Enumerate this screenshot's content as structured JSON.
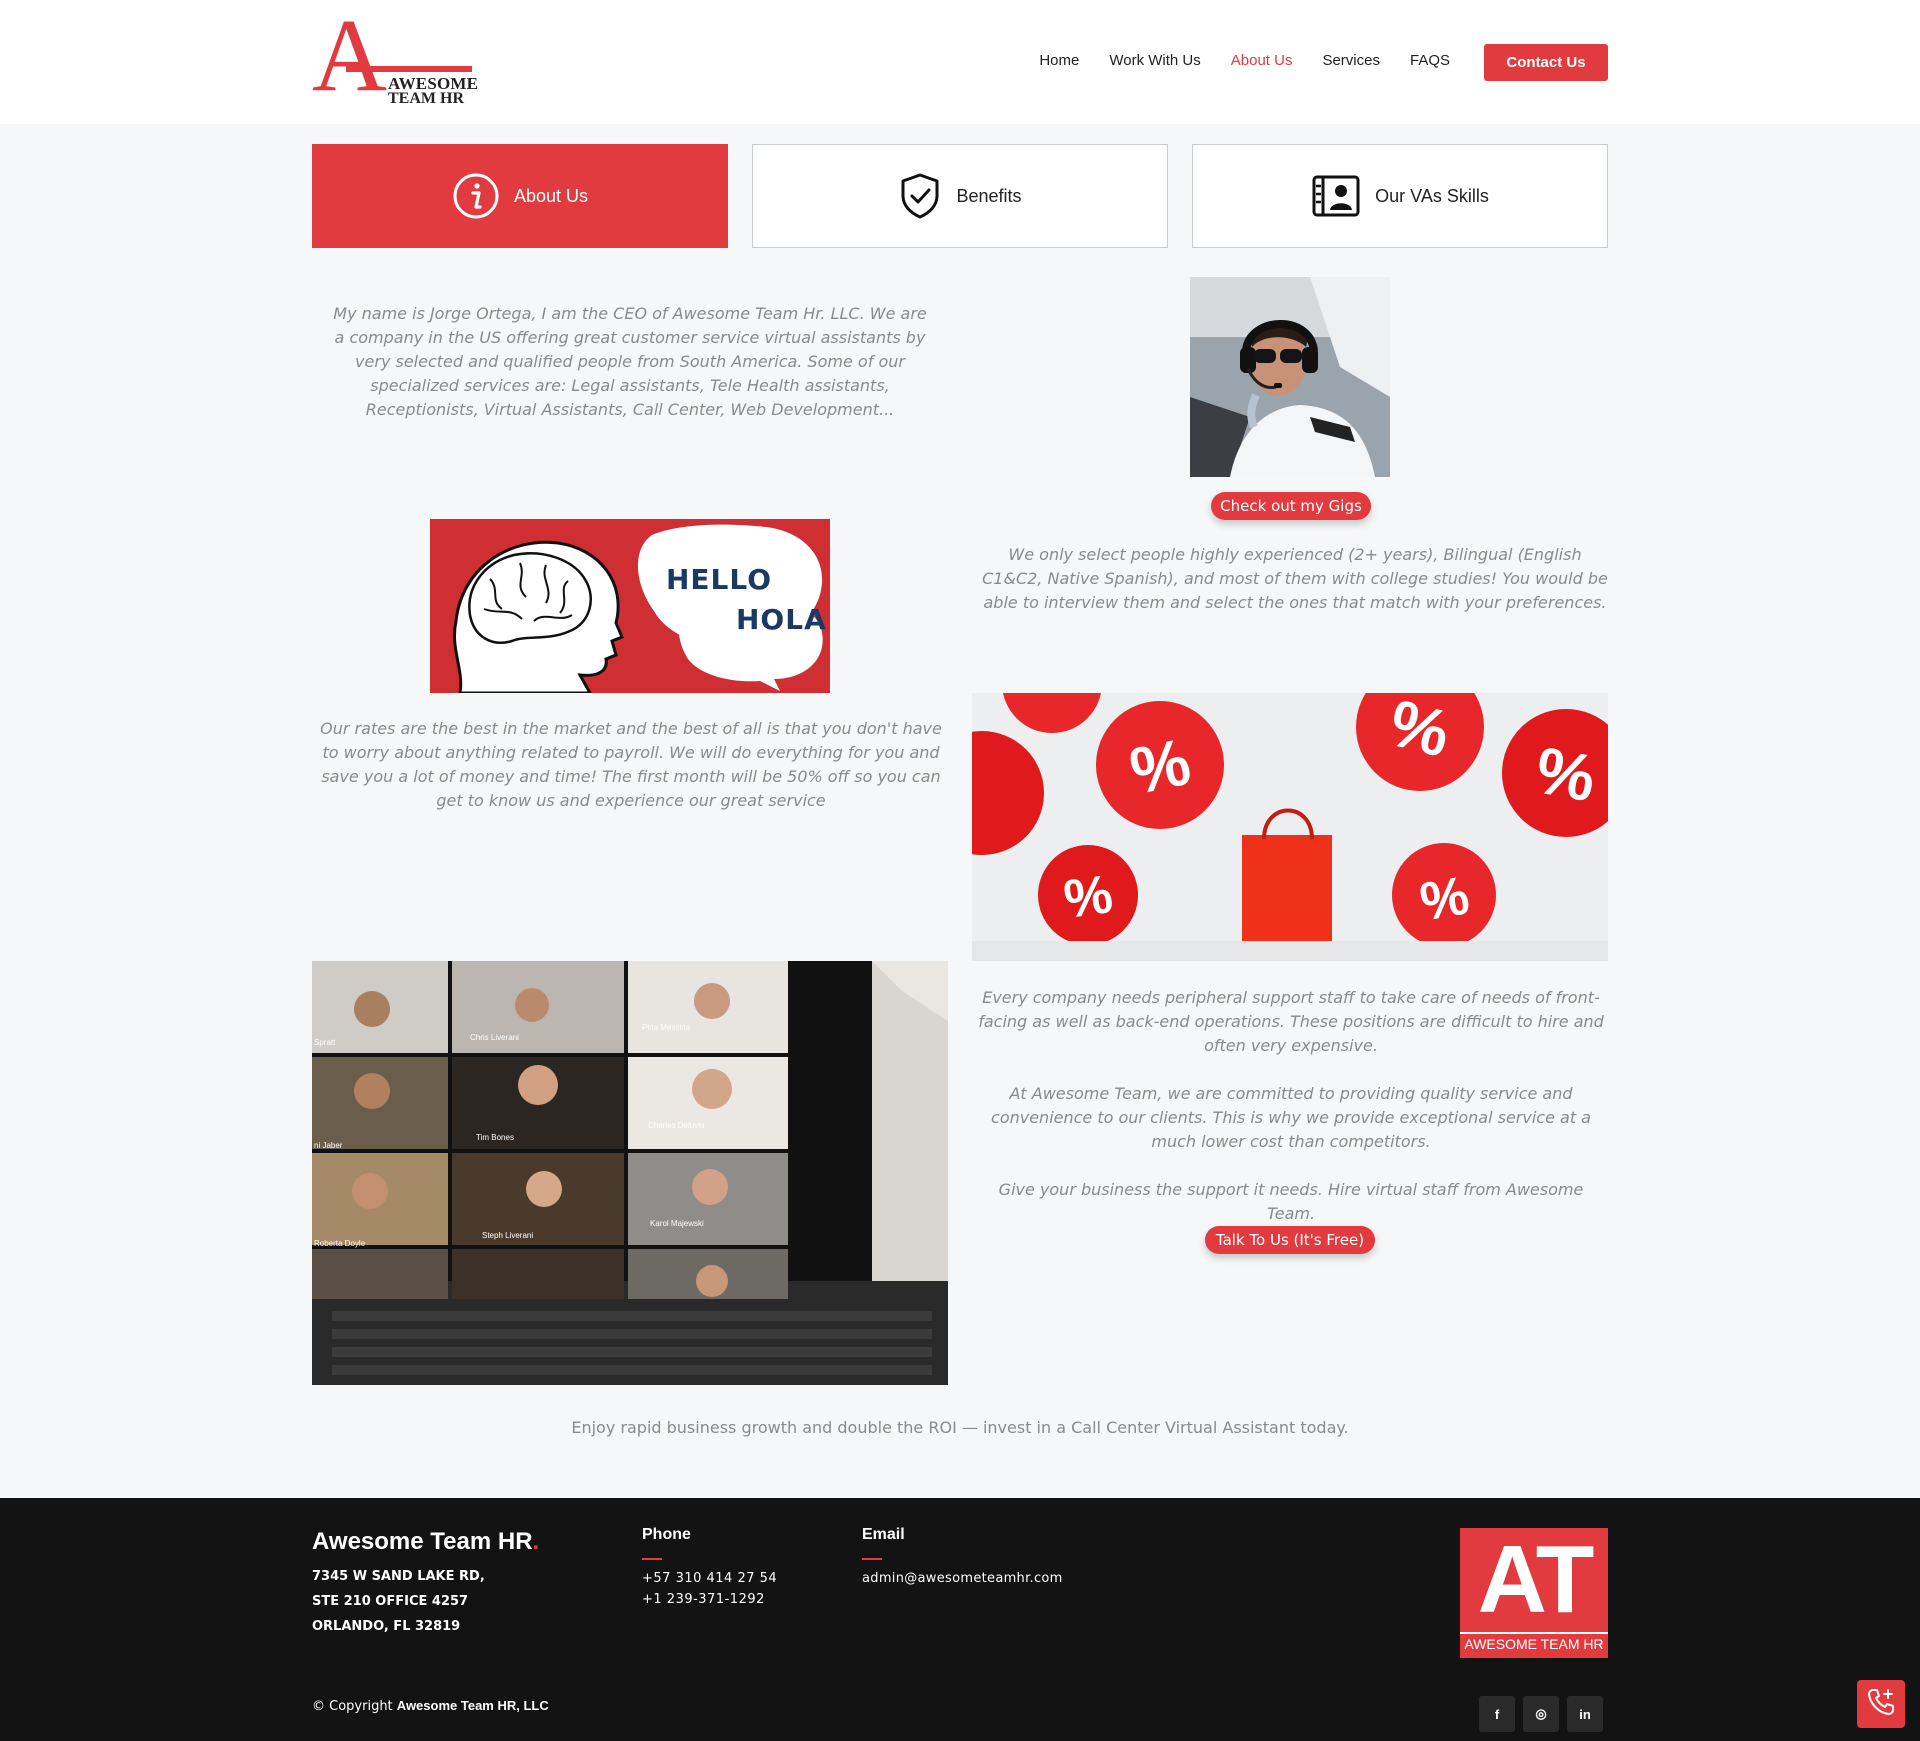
{
  "logo": {
    "letter": "A",
    "line1": "AWESOME",
    "line2": "TEAM HR"
  },
  "nav": {
    "items": [
      "Home",
      "Work With Us",
      "About Us",
      "Services",
      "FAQS"
    ],
    "active": "About Us",
    "contact_label": "Contact Us"
  },
  "tabs": [
    {
      "label": "About Us",
      "icon": "info-icon",
      "active": true
    },
    {
      "label": "Benefits",
      "icon": "shield-check-icon",
      "active": false
    },
    {
      "label": "Our VAs Skills",
      "icon": "profile-card-icon",
      "active": false
    }
  ],
  "about": {
    "intro": "My name is Jorge Ortega, I am the CEO of Awesome Team Hr. LLC. We are a company in the US offering great customer service virtual assistants by very selected and qualified people from South America. Some of our specialized services are: Legal assistants, Tele Health assistants, Receptionists, Virtual Assistants, Call Center, Web Development...",
    "gigs_button": "Check out my Gigs",
    "select": "We only select people highly experienced (2+ years), Bilingual (English C1&C2, Native Spanish), and most of them with college studies! You would be able to interview them and select the ones that match with your preferences.",
    "rates": "Our rates are the best in the market and the best of all is that you don't have to worry about anything related to payroll. We will do everything for you and save you a lot of money and time! The first month will be 50% off so you can get to know us and experience our great service",
    "support": "Every company needs peripheral support staff to take care of needs of front-facing as well as back-end operations. These positions are difficult to hire and often very expensive.",
    "committed": "At Awesome Team, we are committed to providing quality service and convenience to our clients. This is why we provide exceptional service at a much lower cost than competitors.",
    "give": "Give your business the support it needs. Hire virtual staff from Awesome Team.",
    "talk_button": "Talk To Us (It's Free)",
    "bottom": "Enjoy rapid business growth and double the ROI — invest in a Call Center Virtual Assistant today."
  },
  "hello_image": {
    "word1": "HELLO",
    "word2": "HOLA"
  },
  "video_call": {
    "names": [
      "Spratt",
      "Chris Liverani",
      "Pina Messina",
      "ni Jaber",
      "Tim Bones",
      "Charles Deluvio",
      "Roberta Doyle",
      "Steph Liverani",
      "Karol Majewski"
    ]
  },
  "footer": {
    "brand": "Awesome Team HR",
    "brand_dot": ".",
    "address": [
      "7345 W SAND LAKE RD,",
      "STE 210 OFFICE 4257",
      "ORLANDO, FL 32819"
    ],
    "phone_title": "Phone",
    "phones": [
      "+57 310 414 27 54",
      "+1 239-371-1292"
    ],
    "email_title": "Email",
    "email": "admin@awesometeamhr.com",
    "logo_big": "AT",
    "logo_small": "AWESOME TEAM HR",
    "copyright_prefix": "© Copyright",
    "copyright_company": "Awesome Team HR, LLC",
    "social": [
      {
        "name": "facebook-icon",
        "glyph": "f"
      },
      {
        "name": "instagram-icon",
        "glyph": "◎"
      },
      {
        "name": "linkedin-icon",
        "glyph": "in"
      }
    ]
  },
  "colors": {
    "accent": "#e23b3f",
    "footer_bg": "#131313",
    "page_bg": "#f6f7f9",
    "text_muted": "#8a8a8a"
  }
}
